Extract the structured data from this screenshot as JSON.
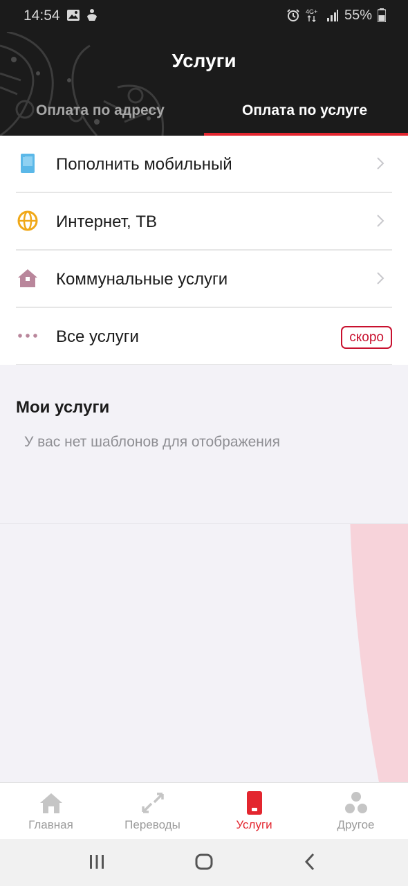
{
  "status_bar": {
    "time": "14:54",
    "network": "4G+",
    "battery": "55%"
  },
  "header": {
    "title": "Услуги"
  },
  "tabs": [
    {
      "label": "Оплата по адресу"
    },
    {
      "label": "Оплата по услуге"
    }
  ],
  "services": [
    {
      "label": "Пополнить мобильный",
      "icon": "mobile-phone-icon",
      "color": "#5bb8e8"
    },
    {
      "label": "Интернет, ТВ",
      "icon": "globe-icon",
      "color": "#f0a818"
    },
    {
      "label": "Коммунальные услуги",
      "icon": "house-icon",
      "color": "#b9869b"
    },
    {
      "label": "Все услуги",
      "icon": "more-dots-icon",
      "color": "#b9869b",
      "badge": "скоро"
    }
  ],
  "my_services": {
    "title": "Мои услуги",
    "empty_text": "У вас нет шаблонов для отображения"
  },
  "bottom_nav": [
    {
      "label": "Главная",
      "icon": "home-icon"
    },
    {
      "label": "Переводы",
      "icon": "transfer-arrows-icon"
    },
    {
      "label": "Услуги",
      "icon": "services-phone-icon",
      "active": true
    },
    {
      "label": "Другое",
      "icon": "other-circles-icon"
    }
  ],
  "colors": {
    "accent": "#e3262f",
    "header_bg": "#1b1b1b",
    "background": "#f3f2f7"
  }
}
